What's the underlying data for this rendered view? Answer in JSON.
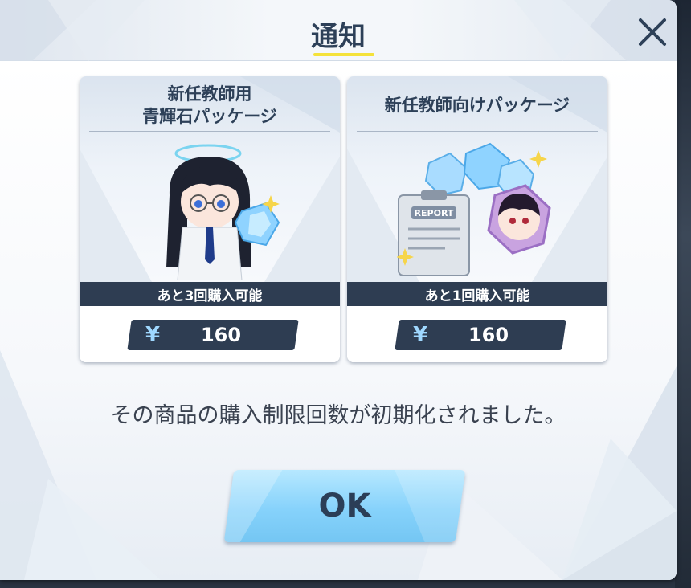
{
  "dialog": {
    "title": "通知",
    "close_icon": "close-icon",
    "message": "その商品の購入制限回数が初期化されました。",
    "ok_label": "OK"
  },
  "packages": [
    {
      "title_line1": "新任教師用",
      "title_line2": "青輝石パッケージ",
      "limit_text": "あと3回購入可能",
      "currency": "¥",
      "price": "160",
      "art_icon": "chibi-character-with-crystal-icon"
    },
    {
      "title_line1": "新任教師向けパッケージ",
      "title_line2": "",
      "limit_text": "あと1回購入可能",
      "currency": "¥",
      "price": "160",
      "art_icon": "report-crystals-portrait-icon"
    }
  ],
  "colors": {
    "title_text": "#2d4058",
    "title_underline": "#f4e23a",
    "banner_dark": "#2e3d52",
    "yen_accent": "#9fd8ff",
    "ok_button": "#86d2fb"
  }
}
